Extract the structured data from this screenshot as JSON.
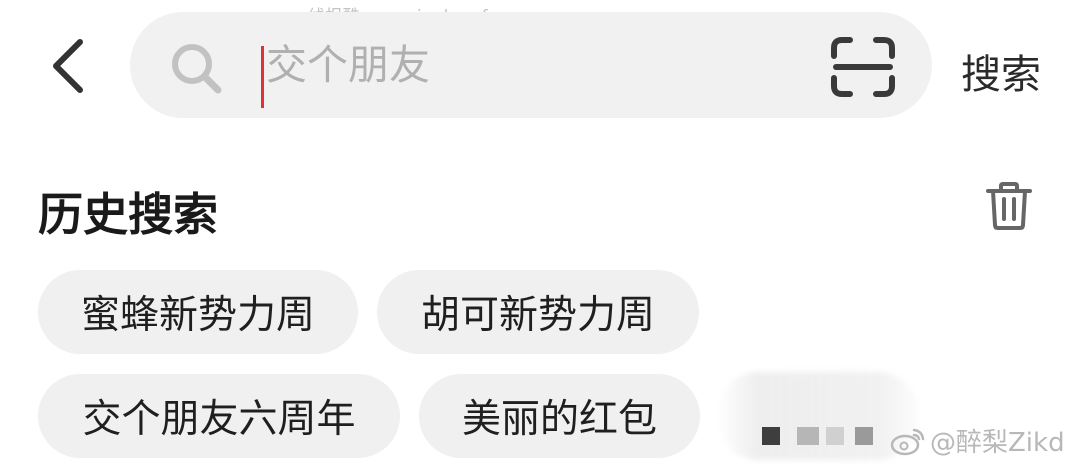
{
  "watermark": {
    "top_text": "线报酷-new.xianbao.fun",
    "weibo_text": "@醉梨Zikd"
  },
  "search": {
    "placeholder": "交个朋友",
    "value": "",
    "submit_label": "搜索"
  },
  "history": {
    "title": "历史搜索",
    "items": [
      {
        "label": "蜜蜂新势力周"
      },
      {
        "label": "胡可新势力周"
      },
      {
        "label": "交个朋友六周年"
      },
      {
        "label": "美丽的红包"
      }
    ]
  },
  "icons": {
    "back": "chevron-left-icon",
    "search": "search-icon",
    "scan": "scan-icon",
    "trash": "trash-icon",
    "weibo": "weibo-icon"
  },
  "colors": {
    "caret": "#e0303a",
    "search_bg": "#f1f1f1",
    "chip_bg": "#f0f0f0",
    "text_primary": "#1a1a1a",
    "placeholder": "#b0b0b0"
  }
}
